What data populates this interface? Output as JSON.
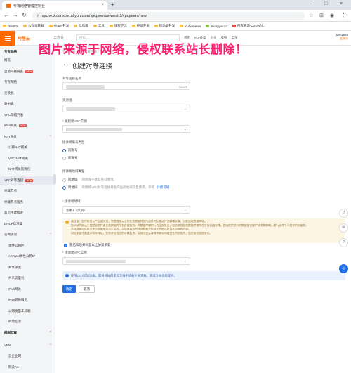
{
  "browser": {
    "tab_title": "专有网络管理控制台",
    "url": "vpcnext.console.aliyun.com/vpcpeer/us-west-1/vpcpeers/new",
    "bookmarks": [
      "RustFS",
      "公众号转载",
      "Flutter开发",
      "优选库",
      "工具",
      "课程学习",
      "终端开发",
      "移动端开发",
      "Kubernetes",
      "Swagger UI",
      "内容管理-CSDN创..."
    ]
  },
  "console": {
    "logo": "阿里云",
    "workspace": "工作台",
    "search_placeholder": "搜索...",
    "top_nav": [
      "费用",
      "ICP备案",
      "企业",
      "支持",
      "工单"
    ],
    "user_name": "jsee1985",
    "user_sub": "主账号"
  },
  "watermark": "图片来源于网络，侵权联系站长删除！",
  "sidebar": {
    "title": "专有网络",
    "items": [
      {
        "label": "概览",
        "type": "item"
      },
      {
        "label": "自助问题排查",
        "type": "item",
        "badge": "NEW"
      },
      {
        "label": "专有网络",
        "type": "item"
      },
      {
        "label": "交换机",
        "type": "item"
      },
      {
        "label": "路由表",
        "type": "item"
      },
      {
        "label": "VPC前缀列表",
        "type": "item"
      },
      {
        "label": "IPv4网关",
        "type": "item",
        "badge": "NEW"
      },
      {
        "label": "NAT网关",
        "type": "group"
      },
      {
        "label": "公网NAT网关",
        "type": "sub"
      },
      {
        "label": "VPC NAT网关",
        "type": "sub"
      },
      {
        "label": "NAT网关资源包",
        "type": "sub"
      },
      {
        "label": "VPC对等连接",
        "type": "item",
        "badge": "NEW",
        "active": true
      },
      {
        "label": "终端节点",
        "type": "item"
      },
      {
        "label": "终端节点服务",
        "type": "item"
      },
      {
        "label": "高可用虚拟IP",
        "type": "item"
      },
      {
        "label": "DHCP选项集",
        "type": "item"
      },
      {
        "label": "公网访问",
        "type": "group"
      },
      {
        "label": "弹性公网IP",
        "type": "sub"
      },
      {
        "label": "Anycast弹性公网IP",
        "type": "sub"
      },
      {
        "label": "共享带宽",
        "type": "sub"
      },
      {
        "label": "共享流量包",
        "type": "sub"
      },
      {
        "label": "IPv6网关",
        "type": "sub"
      },
      {
        "label": "IPv6转换服务",
        "type": "sub"
      },
      {
        "label": "公网质量工具箱",
        "type": "sub"
      },
      {
        "label": "IP地址池",
        "type": "sub"
      },
      {
        "label": "网间互联",
        "type": "head"
      },
      {
        "label": "VPN",
        "type": "group"
      },
      {
        "label": "云企业网",
        "type": "sub"
      },
      {
        "label": "网关A1",
        "type": "sub"
      }
    ]
  },
  "page": {
    "breadcrumb": "专有网络 / VPC对等连接 / 创建",
    "title": "创建对等连接",
    "name_label": "对等连接名称",
    "name_count": "12/128",
    "region_label": "资源组",
    "initiator_label": "发起端VPC实例",
    "account_label": "接收端账号类型",
    "account_options": [
      "同账号",
      "跨账号"
    ],
    "region_type_label": "接收端地域类型",
    "region_options": [
      {
        "label": "同地域",
        "hint": "同地域不收取任何费用。"
      },
      {
        "label": "跨地域",
        "hint": "跨地域VPC对等连接将会产生跨地域流量费用，参考",
        "link": "计费说明"
      }
    ],
    "recv_region_label": "接收端地域",
    "recv_region_value": "华南1（深圳）",
    "warning": [
      "请注意：您将阿里云产品或阿里，将使得您云上的业务数据将您所选择的区域或产品部署区域，可能出现数据跨境。",
      "您同意并确认：您完全拥有该业务数据的所有处理权利，对数据传输的行为全权负责，您应确保您的数据传输符合所有适用法律，包括提供充分的数据安全保护技术和策略，履行获得个人信息的同意等，",
      "完成数据出境安全评估和申报等法定义务。且您承诺您的业务数据不包含任何依法应禁止出境的内容。",
      "如您未遵守前述声明与保证，您将承担相应的法律后果，导致阿里云或其关联公司遭受任何损失的，您应承担赔偿责任。"
    ],
    "agree_label": "我已知悉并同意以上协议条款",
    "recv_vpc_label": "接收端VPC实例",
    "info": "使用CDT跨境功能，需将目标阿里云专线申请的企业资质，跨境专线也能提供。",
    "confirm": "确定",
    "cancel": "取消"
  }
}
